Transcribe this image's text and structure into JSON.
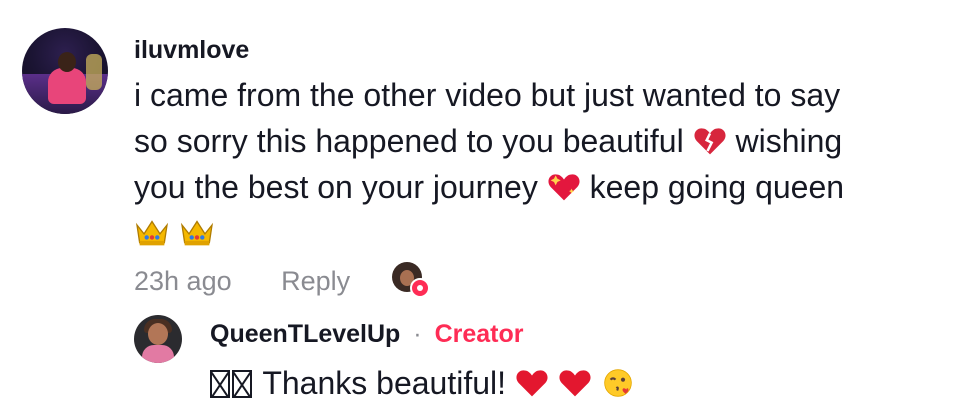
{
  "comment": {
    "username": "iluvmlove",
    "text_line1": "i came from the other video but just wanted to say",
    "text_line2_a": "so sorry this happened to you beautiful",
    "text_line2_b": "wishing",
    "text_line3_a": "you the best on your journey",
    "text_line3_b": "keep going queen",
    "emojis": [
      "broken-heart-icon",
      "sparkling-heart-icon",
      "crown-icon",
      "crown-icon"
    ],
    "time": "23h ago",
    "reply_label": "Reply"
  },
  "reply": {
    "username": "QueenTLevelUp",
    "separator": "·",
    "badge": "Creator",
    "text": "Thanks beautiful!",
    "emojis": [
      "red-heart-icon",
      "red-heart-icon",
      "face-blowing-kiss-icon"
    ]
  },
  "colors": {
    "accent": "#fe2c55",
    "meta": "#8a8b91",
    "text": "#161823"
  }
}
